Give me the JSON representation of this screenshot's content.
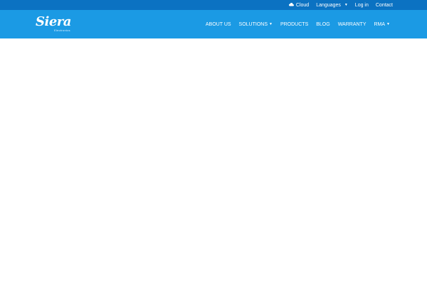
{
  "topbar": {
    "links": [
      {
        "label": "Cloud",
        "icon": "cloud-icon"
      },
      {
        "label": "Languages",
        "icon": "caret-down-icon"
      },
      {
        "label": "Log in"
      },
      {
        "label": "Contact"
      }
    ]
  },
  "header": {
    "logo_text": "Siera",
    "logo_tagline": "Electronics",
    "nav": [
      {
        "label": "ABOUT US"
      },
      {
        "label": "SOLUTIONS",
        "icon": "chevron-down-icon"
      },
      {
        "label": "PRODUCTS"
      },
      {
        "label": "BLOG"
      },
      {
        "label": "WARRANTY"
      },
      {
        "label": "RMA",
        "icon": "chevron-down-icon"
      }
    ]
  },
  "colors": {
    "topbar": "#0b72c2",
    "header": "#1b9ae4",
    "text": "#ffffff"
  }
}
